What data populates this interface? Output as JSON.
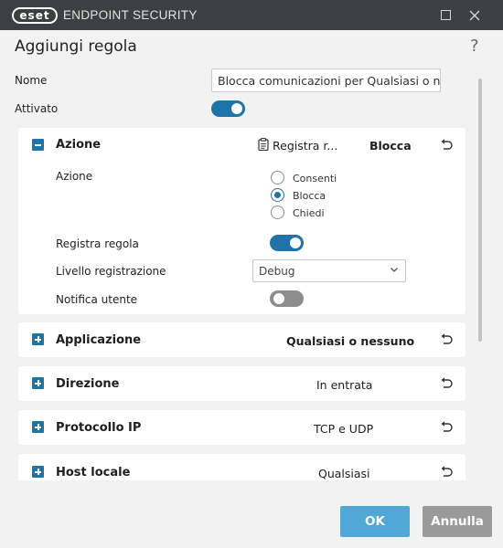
{
  "window": {
    "logo": "eset",
    "title": "ENDPOINT SECURITY",
    "controls": [
      "maximize-icon",
      "close-icon"
    ]
  },
  "header": {
    "title": "Aggiungi regola",
    "help": "?"
  },
  "form": {
    "name_label": "Nome",
    "name_value": "Blocca comunicazioni per Qualsiasi o nes",
    "enabled_label": "Attivato",
    "enabled": true
  },
  "sections": {
    "azione": {
      "title": "Azione",
      "log_summary": "Registra r...",
      "value": "Blocca",
      "action_label": "Azione",
      "options": [
        "Consenti",
        "Blocca",
        "Chiedi"
      ],
      "selected": "Blocca",
      "log_rule_label": "Registra regola",
      "log_rule": true,
      "log_level_label": "Livello registrazione",
      "log_level": "Debug",
      "notify_label": "Notifica utente",
      "notify": false
    },
    "applicazione": {
      "title": "Applicazione",
      "value": "Qualsiasi o nessuno"
    },
    "direzione": {
      "title": "Direzione",
      "value": "In entrata"
    },
    "protocollo": {
      "title": "Protocollo IP",
      "value": "TCP e UDP"
    },
    "host": {
      "title": "Host locale",
      "value": "Qualsiasi"
    }
  },
  "buttons": {
    "ok": "OK",
    "cancel": "Annulla"
  },
  "colors": {
    "accent": "#1e73a8",
    "ok_button": "#4fa8d6",
    "cancel_button": "#9a9a9a",
    "titlebar": "#3c3f43"
  }
}
